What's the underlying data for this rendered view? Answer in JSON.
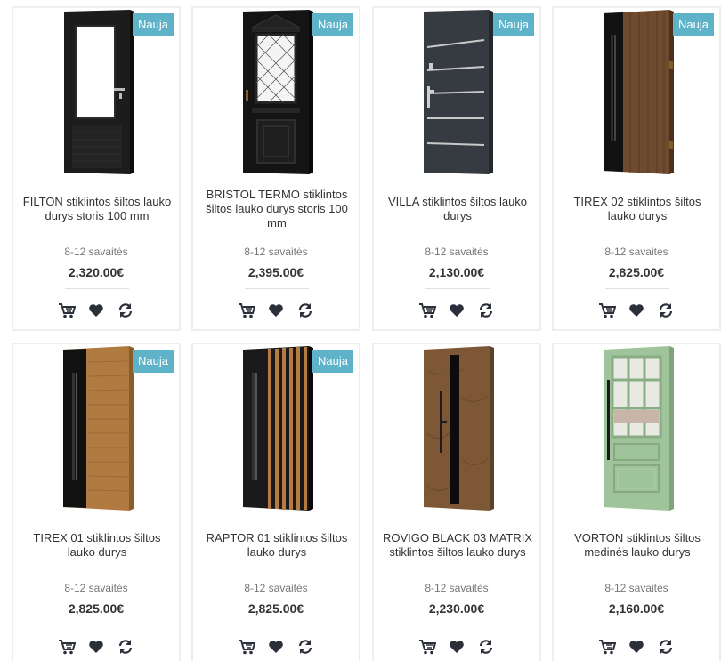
{
  "products": [
    {
      "title": "FILTON stiklintos šiltos lauko durys storis 100 mm",
      "delivery": "8-12 savaitės",
      "price": "2,320.00€",
      "badge": "Nauja",
      "door_style": "filton"
    },
    {
      "title": "BRISTOL TERMO stiklintos šiltos lauko durys storis 100 mm",
      "delivery": "8-12 savaitės",
      "price": "2,395.00€",
      "badge": "Nauja",
      "door_style": "bristol"
    },
    {
      "title": "VILLA stiklintos šiltos lauko durys",
      "delivery": "8-12 savaitės",
      "price": "2,130.00€",
      "badge": "Nauja",
      "door_style": "villa"
    },
    {
      "title": "TIREX 02 stiklintos šiltos lauko durys",
      "delivery": "8-12 savaitės",
      "price": "2,825.00€",
      "badge": "Nauja",
      "door_style": "tirex02"
    },
    {
      "title": "TIREX 01 stiklintos šiltos lauko durys",
      "delivery": "8-12 savaitės",
      "price": "2,825.00€",
      "badge": "Nauja",
      "door_style": "tirex01"
    },
    {
      "title": "RAPTOR 01 stiklintos šiltos lauko durys",
      "delivery": "8-12 savaitės",
      "price": "2,825.00€",
      "badge": "Nauja",
      "door_style": "raptor"
    },
    {
      "title": "ROVIGO BLACK 03 MATRIX stiklintos šiltos lauko durys",
      "delivery": "8-12 savaitės",
      "price": "2,230.00€",
      "badge": "",
      "door_style": "rovigo"
    },
    {
      "title": "VORTON stiklintos šiltos medinės lauko durys",
      "delivery": "8-12 savaitės",
      "price": "2,160.00€",
      "badge": "",
      "door_style": "vorton"
    }
  ],
  "icons": {
    "cart": "cart-icon",
    "wishlist": "heart-icon",
    "compare": "refresh-icon"
  },
  "colors": {
    "badge": "#5eb3c9",
    "icon": "#2b2f3a",
    "border": "#eeeeee"
  }
}
